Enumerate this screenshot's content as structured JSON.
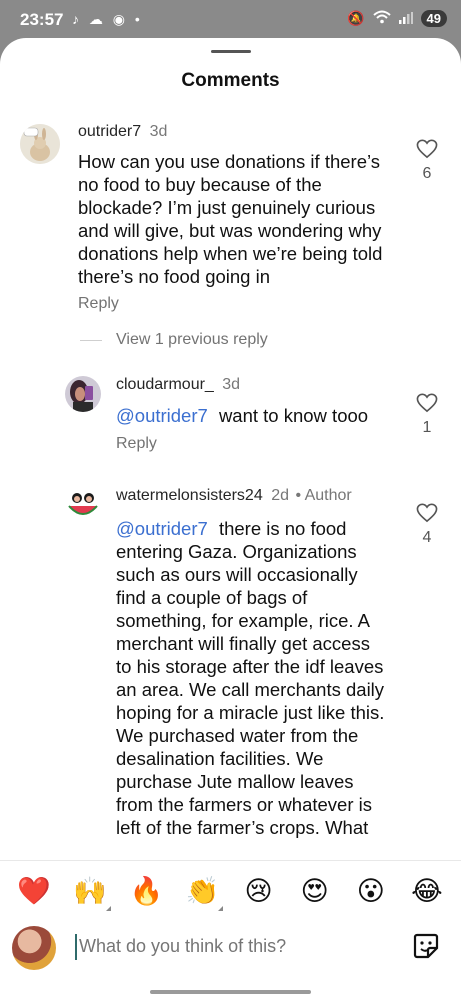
{
  "status": {
    "time": "23:57",
    "notifications": "♪ ☁ ◉ •",
    "battery": "49"
  },
  "header": {
    "title": "Comments"
  },
  "comments": [
    {
      "username": "outrider7",
      "time": "3d",
      "text": "How can you use donations if there’s no food to buy because of the blockade? I’m just genuinely curious and will give, but was wondering why donations help when we’re being told there’s no food going in",
      "likes": "6",
      "reply_label": "Reply"
    },
    {
      "username": "cloudarmour_",
      "time": "3d",
      "mention": "@outrider7",
      "text": "want to know tooo",
      "likes": "1",
      "reply_label": "Reply"
    },
    {
      "username": "watermelonsisters24",
      "time": "2d",
      "author_badge": "• Author",
      "mention": "@outrider7",
      "text": "there is no food entering Gaza. Organizations such as ours will occasionally find a couple of bags of something, for example, rice. A merchant will finally get access to his storage after the idf leaves an area. We call merchants daily hoping for a miracle just like this. We purchased water from the desalination facilities. We purchase Jute mallow leaves from the farmers or whatever is left of the farmer’s crops. What",
      "likes": "4"
    }
  ],
  "view_previous": "View 1 previous reply",
  "emoji_bar": [
    "❤️",
    "🙌",
    "🔥",
    "👏",
    "😢",
    "😍",
    "😮",
    "😂"
  ],
  "composer": {
    "placeholder": "What do you think of this?"
  },
  "colors": {
    "mention": "#3b6fd0",
    "heart": "#ed2f52"
  }
}
